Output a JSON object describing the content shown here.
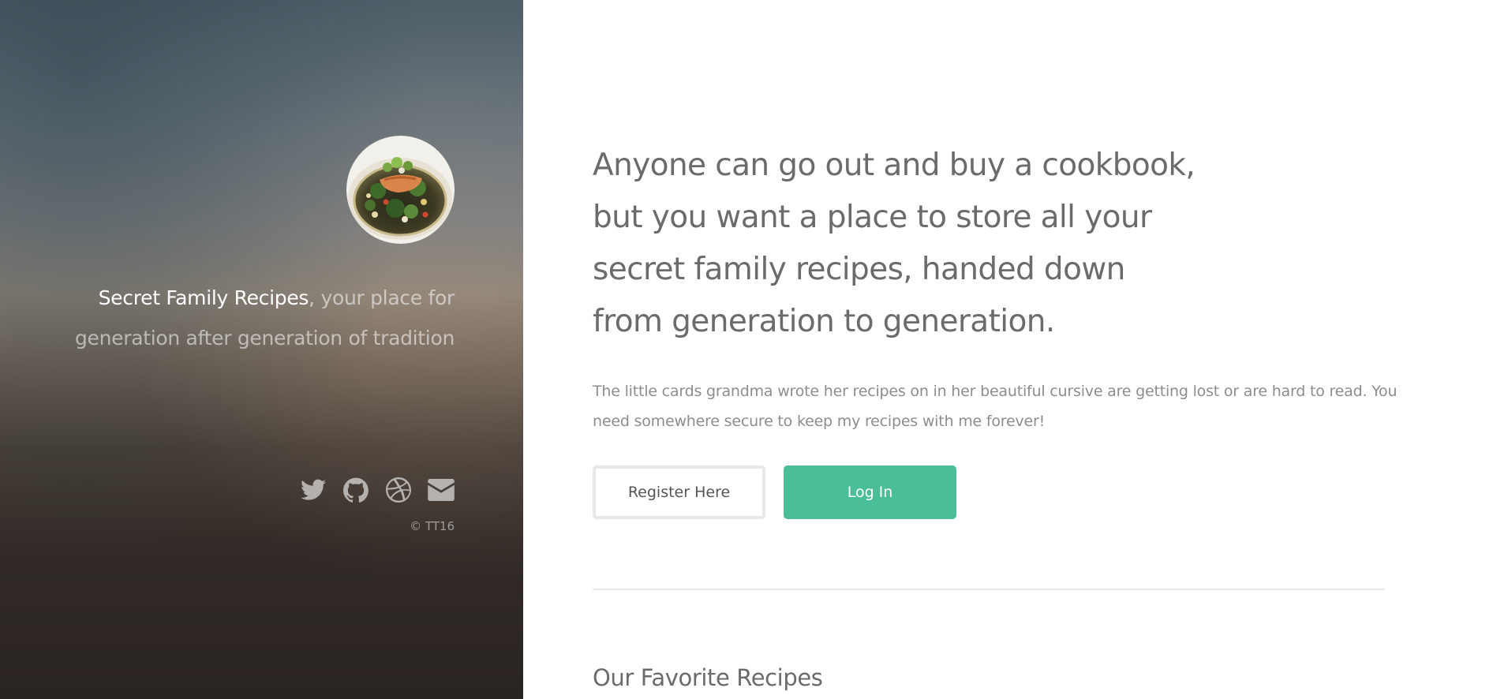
{
  "sidebar": {
    "avatar_alt": "plated fish dish",
    "brand": "Secret Family Recipes",
    "tagline_rest": ", your place for generation after generation of tradition",
    "social": [
      {
        "icon": "twitter-icon"
      },
      {
        "icon": "github-icon"
      },
      {
        "icon": "dribbble-icon"
      },
      {
        "icon": "email-icon"
      }
    ],
    "copyright": "© TT16"
  },
  "main": {
    "headline_lines": [
      "Anyone can go out and buy a cookbook,",
      "but you want a place to store all your",
      "secret family recipes, handed down",
      "from generation to generation."
    ],
    "intro": "The little cards grandma wrote her recipes on in her beautiful cursive are getting lost or are hard to read. You need somewhere secure to keep my recipes with me forever!",
    "register_label": "Register Here",
    "login_label": "Log In",
    "section_title": "Our Favorite Recipes"
  },
  "colors": {
    "accent": "#49be99",
    "heading_text": "#6b6b6b",
    "body_text": "#8d8d8d"
  }
}
